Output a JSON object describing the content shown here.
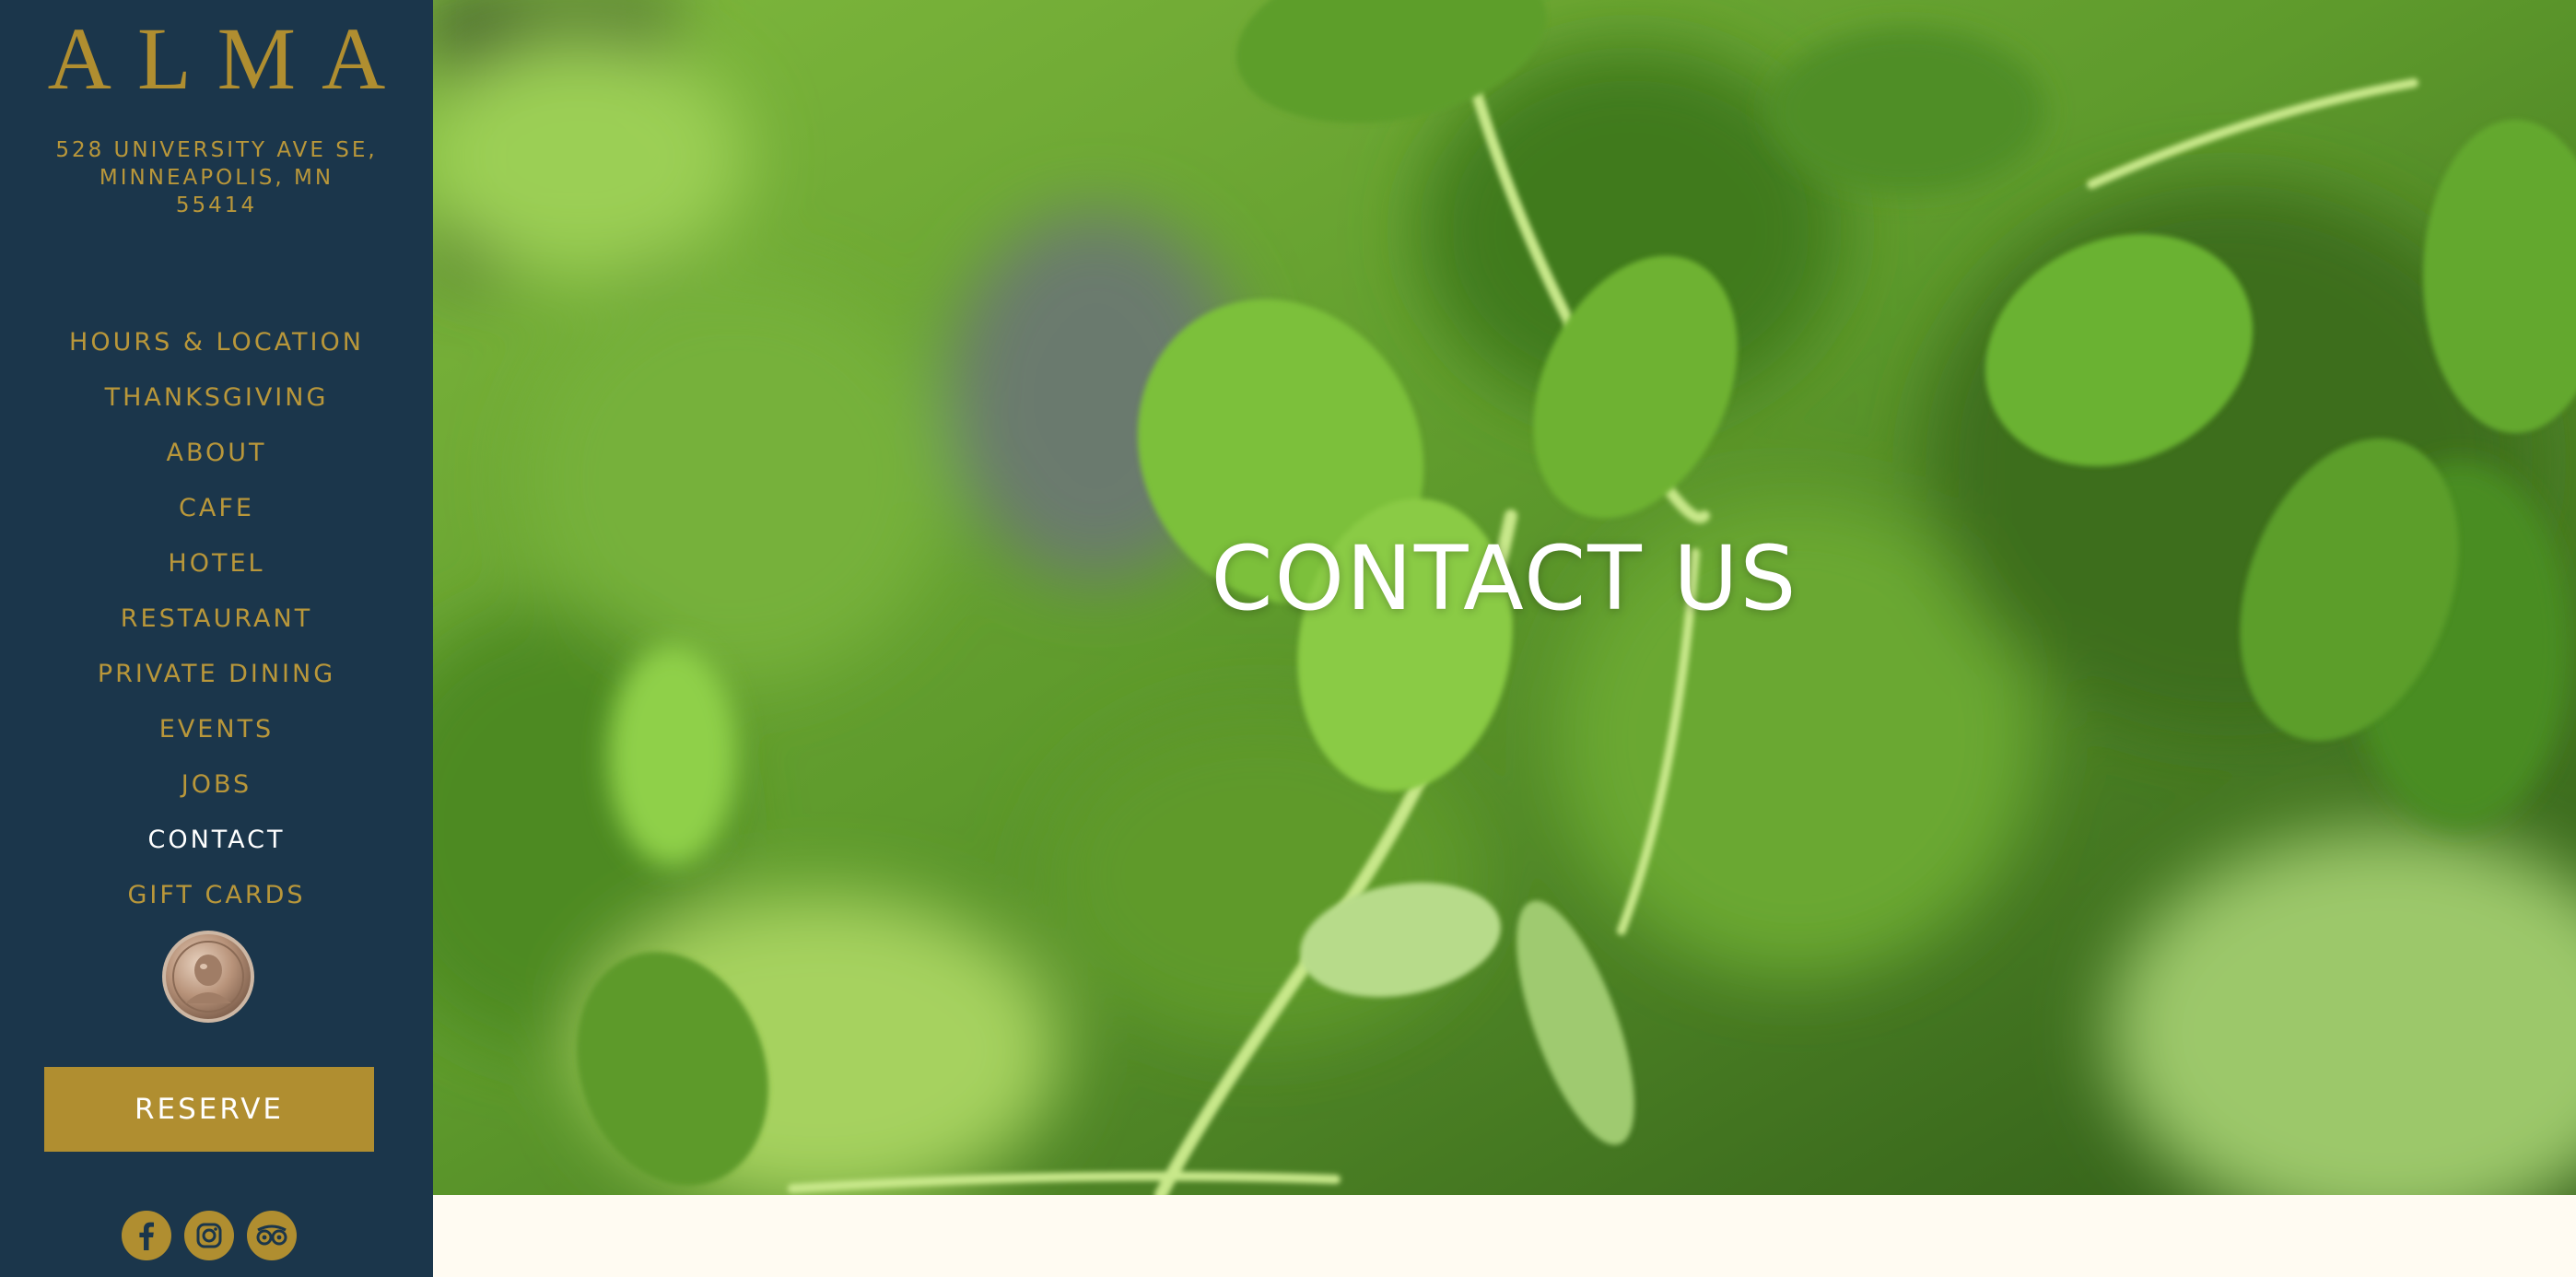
{
  "brand": {
    "name": "ALMA",
    "color": "#b08e30"
  },
  "address": {
    "line1": "528 UNIVERSITY AVE SE,",
    "line2": "MINNEAPOLIS, MN",
    "line3": "55414"
  },
  "nav": {
    "items": [
      {
        "label": "HOURS & LOCATION"
      },
      {
        "label": "THANKSGIVING"
      },
      {
        "label": "ABOUT"
      },
      {
        "label": "CAFE"
      },
      {
        "label": "HOTEL"
      },
      {
        "label": "RESTAURANT"
      },
      {
        "label": "PRIVATE DINING"
      },
      {
        "label": "EVENTS"
      },
      {
        "label": "JOBS"
      },
      {
        "label": "CONTACT",
        "active": true
      },
      {
        "label": "GIFT CARDS"
      }
    ]
  },
  "award": {
    "icon": "james-beard-medal-icon"
  },
  "reserve": {
    "label": "RESERVE"
  },
  "social": [
    {
      "icon": "facebook-icon"
    },
    {
      "icon": "instagram-icon"
    },
    {
      "icon": "tripadvisor-icon"
    }
  ],
  "hero": {
    "title": "CONTACT US"
  },
  "colors": {
    "sidebar": "#1b364b",
    "gold": "#b08e30",
    "page_background": "#fffbf2",
    "active_nav": "#ffffff"
  }
}
